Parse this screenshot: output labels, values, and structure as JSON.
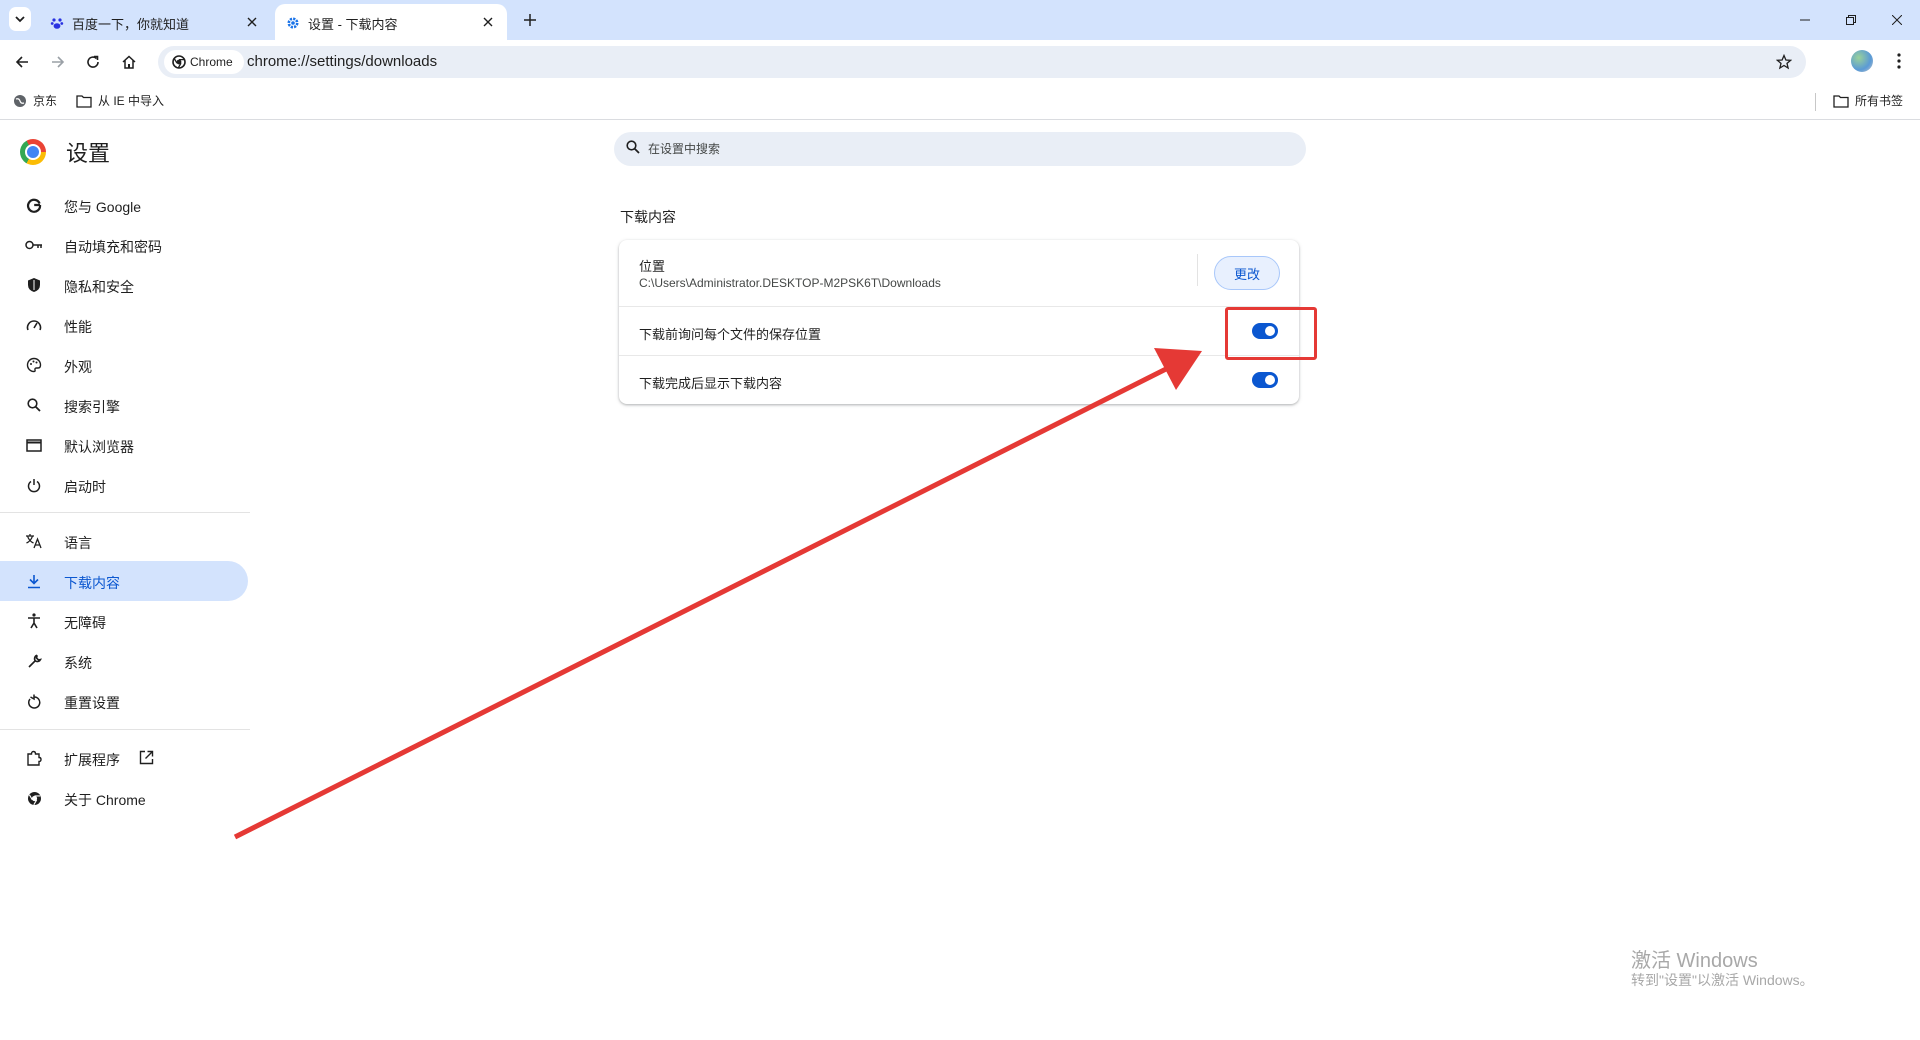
{
  "tabs": [
    {
      "title": "百度一下，你就知道",
      "favicon": "baidu-paw-icon",
      "active": false
    },
    {
      "title": "设置 - 下载内容",
      "favicon": "gear-icon",
      "active": true
    }
  ],
  "toolbar": {
    "site_chip": "Chrome",
    "url": "chrome://settings/downloads"
  },
  "bookmarks": {
    "items": [
      "京东",
      "从 IE 中导入"
    ],
    "all_bookmarks": "所有书签"
  },
  "sidebar": {
    "title": "设置",
    "items": [
      {
        "label": "您与 Google",
        "icon": "google-g-icon"
      },
      {
        "label": "自动填充和密码",
        "icon": "key-icon"
      },
      {
        "label": "隐私和安全",
        "icon": "shield-icon"
      },
      {
        "label": "性能",
        "icon": "speedometer-icon"
      },
      {
        "label": "外观",
        "icon": "palette-icon"
      },
      {
        "label": "搜索引擎",
        "icon": "search-icon"
      },
      {
        "label": "默认浏览器",
        "icon": "browser-window-icon"
      },
      {
        "label": "启动时",
        "icon": "power-icon"
      },
      {
        "label": "语言",
        "icon": "translate-icon"
      },
      {
        "label": "下载内容",
        "icon": "download-icon",
        "selected": true
      },
      {
        "label": "无障碍",
        "icon": "accessibility-icon"
      },
      {
        "label": "系统",
        "icon": "wrench-icon"
      },
      {
        "label": "重置设置",
        "icon": "reset-icon"
      },
      {
        "label": "扩展程序",
        "icon": "puzzle-icon"
      },
      {
        "label": "关于 Chrome",
        "icon": "chrome-icon"
      }
    ]
  },
  "search": {
    "placeholder": "在设置中搜索"
  },
  "downloads": {
    "section_title": "下载内容",
    "location_label": "位置",
    "location_path": "C:\\Users\\Administrator.DESKTOP-M2PSK6T\\Downloads",
    "change_button": "更改",
    "ask_where_label": "下载前询问每个文件的保存位置",
    "ask_where_on": true,
    "show_when_done_label": "下载完成后显示下载内容",
    "show_when_done_on": true
  },
  "watermark": {
    "title": "激活 Windows",
    "subtitle": "转到\"设置\"以激活 Windows。"
  },
  "colors": {
    "accent": "#0b57d0",
    "selected_bg": "#d3e3fd",
    "annotation_red": "#e53935"
  }
}
